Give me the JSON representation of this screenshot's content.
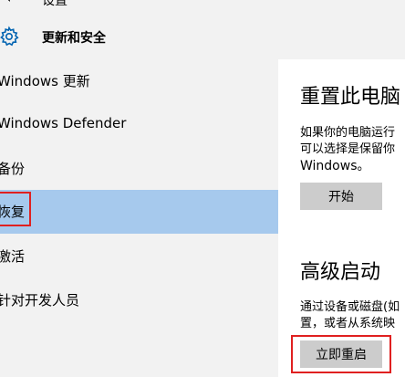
{
  "header": {
    "back_label": "设置",
    "title": "更新和安全"
  },
  "sidebar": {
    "items": [
      {
        "label": "Windows 更新"
      },
      {
        "label": "Windows Defender"
      },
      {
        "label": "备份"
      },
      {
        "label": "恢复"
      },
      {
        "label": "激活"
      },
      {
        "label": "针对开发人员"
      }
    ],
    "selected_index": 3
  },
  "reset_section": {
    "title": "重置此电脑",
    "desc_lines": [
      "如果你的电脑运行",
      "可以选择是保留你",
      "Windows。"
    ],
    "button_label": "开始"
  },
  "advanced_section": {
    "title": "高级启动",
    "desc_lines": [
      "通过设备或磁盘(如",
      "置，或者从系统映"
    ],
    "button_label": "立即重启"
  },
  "colors": {
    "sidebar_bg": "#f2f2f2",
    "selected_bg": "#a6c9ed",
    "button_bg": "#cccccc",
    "highlight": "#e02020",
    "accent": "#0063b1"
  }
}
